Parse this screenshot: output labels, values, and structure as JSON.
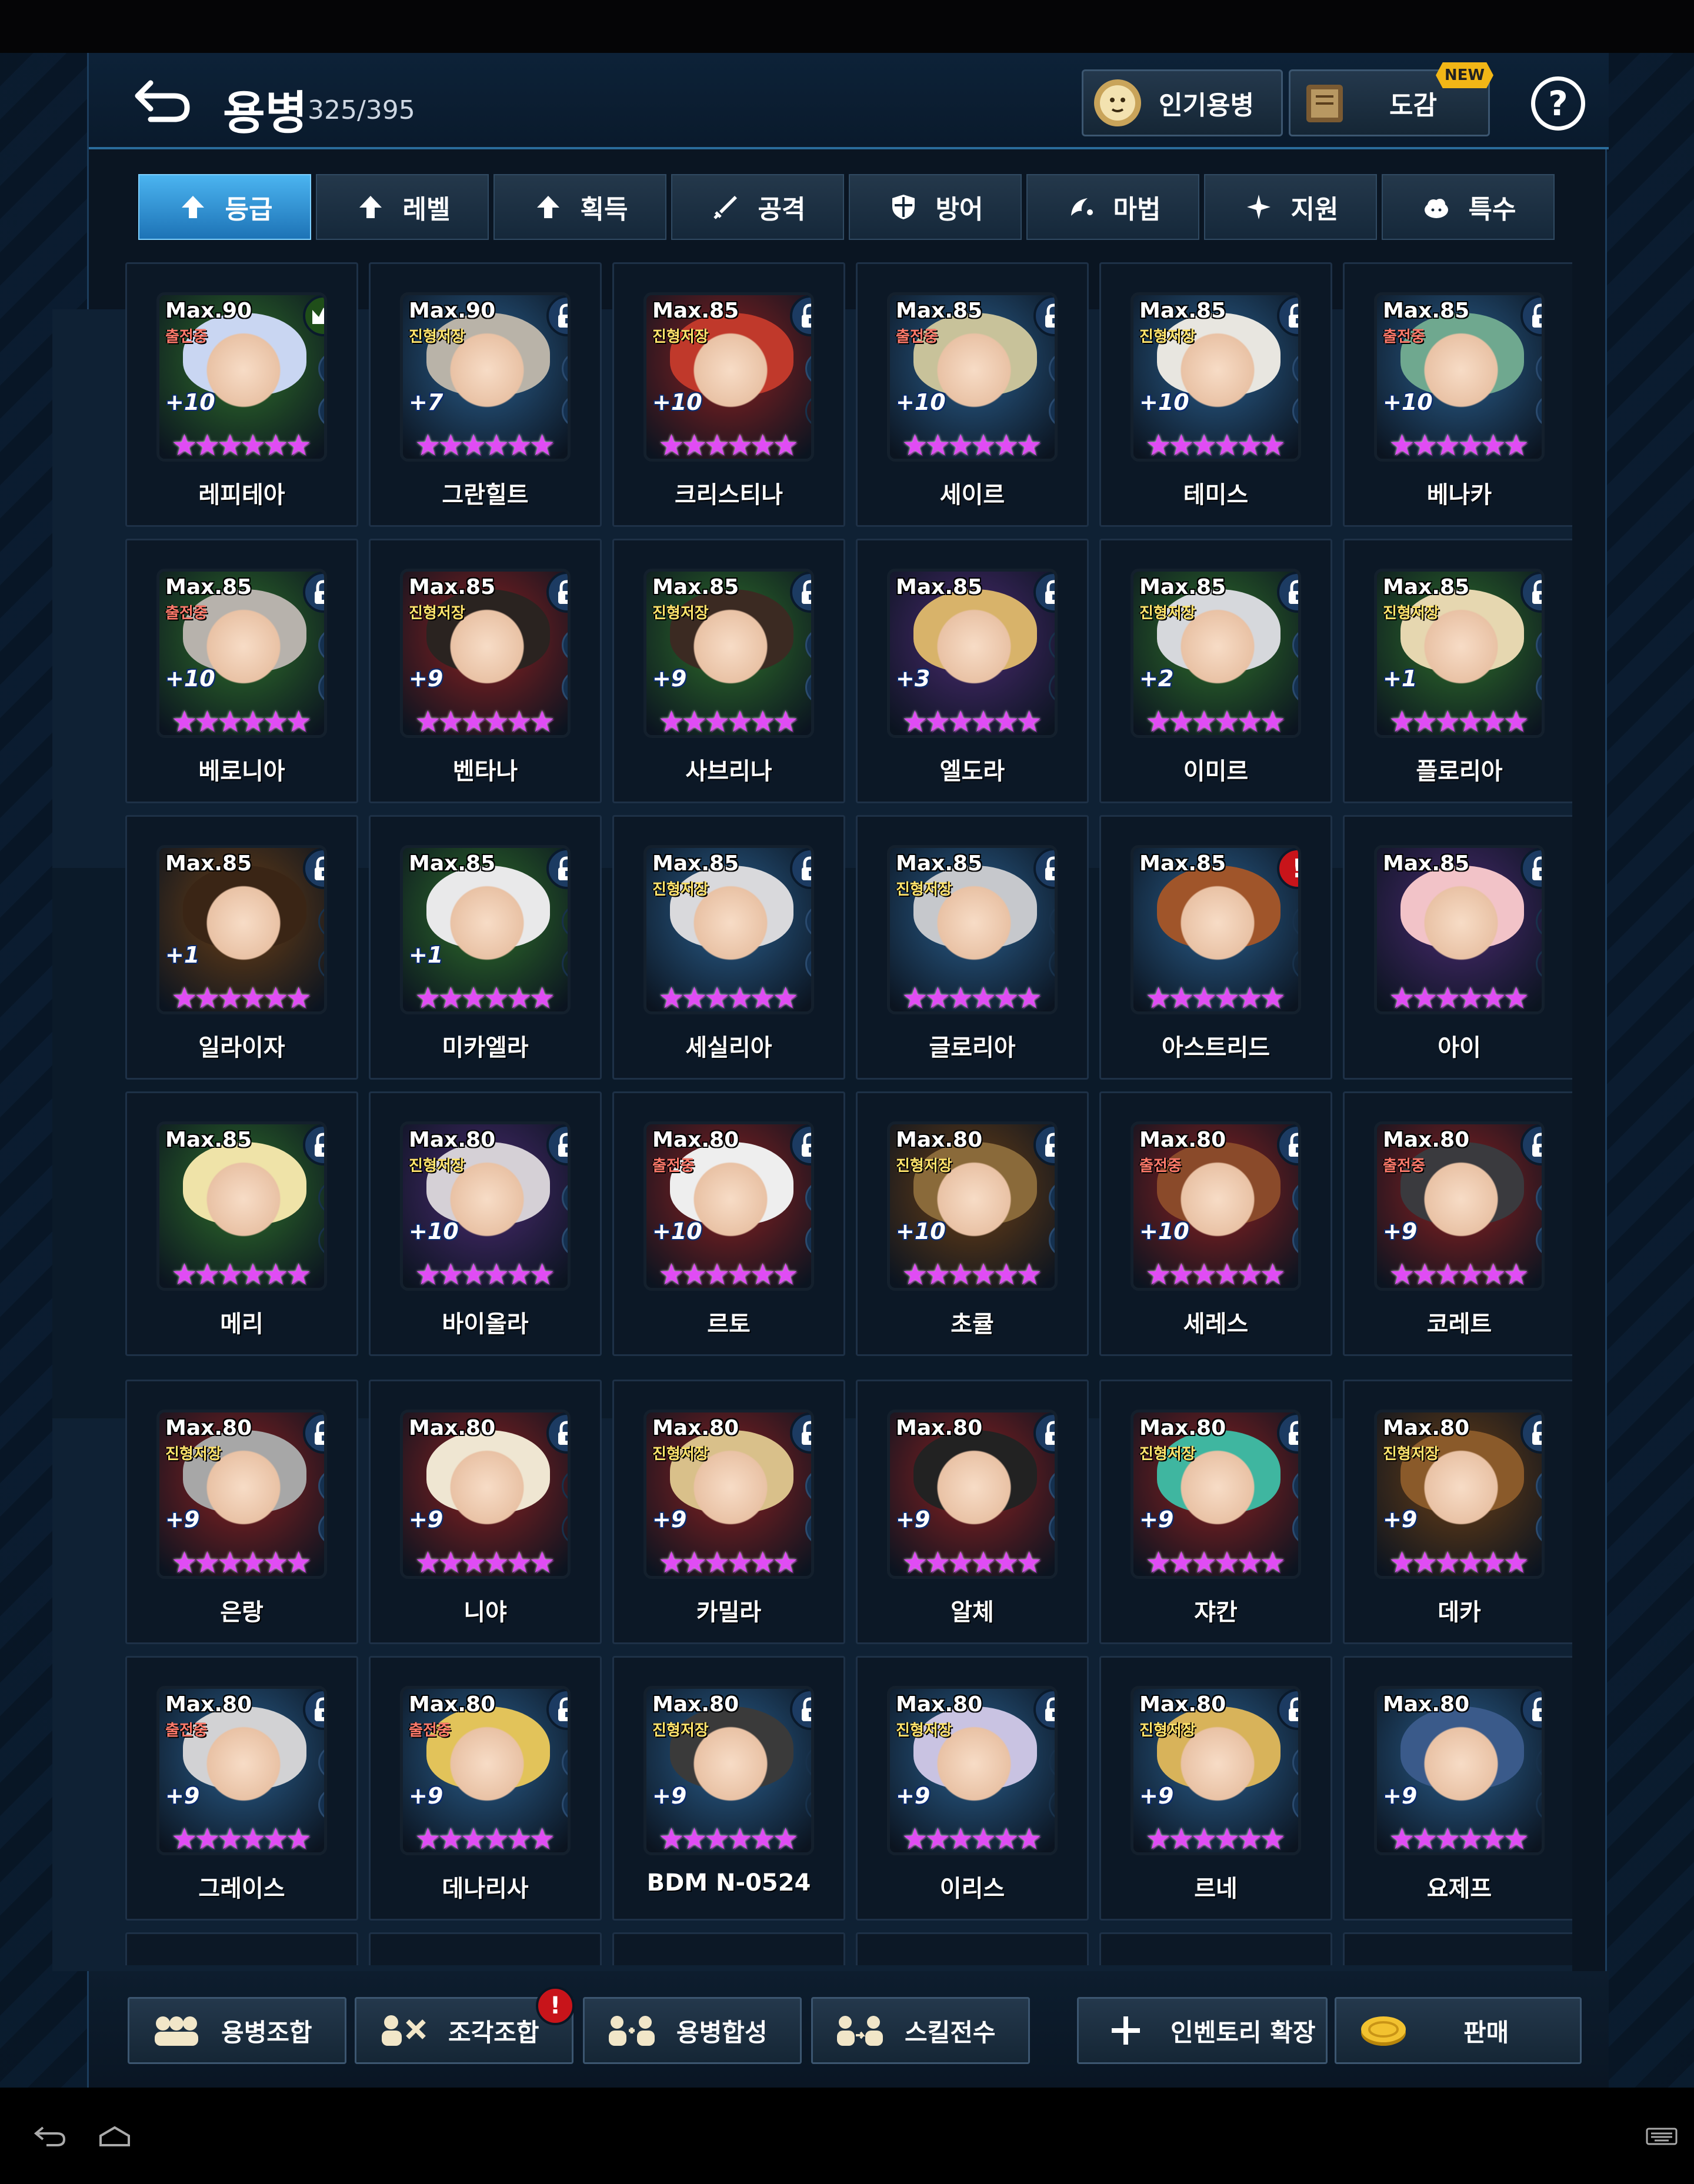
{
  "header": {
    "title": "용병",
    "count": "325/395",
    "popular_label": "인기용병",
    "book_label": "도감",
    "new_badge": "NEW",
    "help_label": "?"
  },
  "tabs": [
    {
      "label": "등급",
      "icon": "arrow-up-icon",
      "selected": true
    },
    {
      "label": "레벨",
      "icon": "arrow-up-icon",
      "selected": false
    },
    {
      "label": "획득",
      "icon": "arrow-up-icon",
      "selected": false
    },
    {
      "label": "공격",
      "icon": "sword-icon",
      "selected": false
    },
    {
      "label": "방어",
      "icon": "shield-icon",
      "selected": false
    },
    {
      "label": "마법",
      "icon": "magic-icon",
      "selected": false
    },
    {
      "label": "지원",
      "icon": "sparkle-icon",
      "selected": false
    },
    {
      "label": "특수",
      "icon": "cloud-icon",
      "selected": false
    }
  ],
  "heroes": [
    {
      "name": "레피테아",
      "max": "Max.90",
      "status": "출전중",
      "plus": "+10",
      "badge": "crown",
      "art": "#2f6f2a",
      "hair": "#c9d6f2",
      "runes": [
        "rune",
        "rune"
      ]
    },
    {
      "name": "그란힐트",
      "max": "Max.90",
      "status": "진형저장",
      "plus": "+7",
      "badge": "lock",
      "art": "#2a5e8c",
      "hair": "#b9b3a8",
      "runes": [
        "rune",
        "rune"
      ]
    },
    {
      "name": "크리스티나",
      "max": "Max.85",
      "status": "진형저장",
      "plus": "+10",
      "badge": "lock",
      "art": "#8b2020",
      "hair": "#c0392b",
      "runes": [
        "rune",
        "empty"
      ]
    },
    {
      "name": "세이르",
      "max": "Max.85",
      "status": "출전중",
      "plus": "+10",
      "badge": "lock",
      "art": "#2a5e8c",
      "hair": "#c8c29a",
      "runes": [
        "rune",
        "rune"
      ]
    },
    {
      "name": "테미스",
      "max": "Max.85",
      "status": "진형저장",
      "plus": "+10",
      "badge": "lock",
      "art": "#2a5e8c",
      "hair": "#e8e6e0",
      "runes": [
        "rune",
        "rune"
      ]
    },
    {
      "name": "베나카",
      "max": "Max.85",
      "status": "출전중",
      "plus": "+10",
      "badge": "lock",
      "art": "#2a5e8c",
      "hair": "#6fa88f",
      "runes": [
        "rune",
        "rune"
      ]
    },
    {
      "name": "베로니아",
      "max": "Max.85",
      "status": "출전중",
      "plus": "+10",
      "badge": "lock",
      "art": "#2f6f2a",
      "hair": "#b7b2ac",
      "runes": [
        "rune",
        "rune"
      ]
    },
    {
      "name": "벤타나",
      "max": "Max.85",
      "status": "진형저장",
      "plus": "+9",
      "badge": "lock",
      "art": "#8b2020",
      "hair": "#2a2320",
      "runes": [
        "rune",
        "rune"
      ]
    },
    {
      "name": "사브리나",
      "max": "Max.85",
      "status": "진형저장",
      "plus": "+9",
      "badge": "lock",
      "art": "#2f6f2a",
      "hair": "#3b2a22",
      "runes": [
        "rune",
        "rune"
      ]
    },
    {
      "name": "엘도라",
      "max": "Max.85",
      "status": "",
      "plus": "+3",
      "badge": "lock",
      "art": "#4a2a70",
      "hair": "#d8b36a",
      "runes": [
        "empty",
        "empty"
      ]
    },
    {
      "name": "이미르",
      "max": "Max.85",
      "status": "진형저장",
      "plus": "+2",
      "badge": "lock",
      "art": "#2f6f2a",
      "hair": "#d6d8dc",
      "runes": [
        "rune",
        "rune"
      ]
    },
    {
      "name": "플로리아",
      "max": "Max.85",
      "status": "진형저장",
      "plus": "+1",
      "badge": "lock",
      "art": "#2f6f2a",
      "hair": "#e6d7b0",
      "runes": [
        "rune",
        "rune"
      ]
    },
    {
      "name": "일라이자",
      "max": "Max.85",
      "status": "",
      "plus": "+1",
      "badge": "lock",
      "art": "#6b3f15",
      "hair": "#3a2515",
      "runes": [
        "empty",
        "empty"
      ]
    },
    {
      "name": "미카엘라",
      "max": "Max.85",
      "status": "",
      "plus": "+1",
      "badge": "lock",
      "art": "#2f6f2a",
      "hair": "#e9e9ea",
      "runes": [
        "empty",
        "empty"
      ]
    },
    {
      "name": "세실리아",
      "max": "Max.85",
      "status": "진형저장",
      "plus": "",
      "badge": "lock",
      "art": "#2a5e8c",
      "hair": "#d9d9dc",
      "runes": [
        "rune",
        "rune"
      ]
    },
    {
      "name": "글로리아",
      "max": "Max.85",
      "status": "진형저장",
      "plus": "",
      "badge": "lock",
      "art": "#2a5e8c",
      "hair": "#c6c8cc",
      "runes": [
        "empty",
        "empty"
      ]
    },
    {
      "name": "아스트리드",
      "max": "Max.85",
      "status": "",
      "plus": "",
      "badge": "alert",
      "art": "#2a5e8c",
      "hair": "#a0552a",
      "runes": [
        "empty",
        "empty"
      ]
    },
    {
      "name": "아이",
      "max": "Max.85",
      "status": "",
      "plus": "",
      "badge": "lock",
      "art": "#4a2a70",
      "hair": "#f2c3c8",
      "runes": [
        "empty",
        "empty"
      ]
    },
    {
      "name": "메리",
      "max": "Max.85",
      "status": "",
      "plus": "",
      "badge": "lock",
      "art": "#2f6f2a",
      "hair": "#efe3a8",
      "runes": [
        "empty",
        "empty"
      ]
    },
    {
      "name": "바이올라",
      "max": "Max.80",
      "status": "진형저장",
      "plus": "+10",
      "badge": "lock",
      "art": "#4a2a70",
      "hair": "#d5d0d6",
      "runes": [
        "rune",
        "rune"
      ]
    },
    {
      "name": "르토",
      "max": "Max.80",
      "status": "출전중",
      "plus": "+10",
      "badge": "lock",
      "art": "#8b2020",
      "hair": "#eeeeee",
      "runes": [
        "rune",
        "rune"
      ]
    },
    {
      "name": "초큘",
      "max": "Max.80",
      "status": "진형저장",
      "plus": "+10",
      "badge": "lock",
      "art": "#6b3f15",
      "hair": "#8a6a3a",
      "runes": [
        "rune",
        "rune"
      ]
    },
    {
      "name": "세레스",
      "max": "Max.80",
      "status": "출전중",
      "plus": "+10",
      "badge": "lock",
      "art": "#8b2020",
      "hair": "#8a4a2a",
      "runes": [
        "rune",
        "rune"
      ]
    },
    {
      "name": "코레트",
      "max": "Max.80",
      "status": "출전중",
      "plus": "+9",
      "badge": "lock",
      "art": "#8b2020",
      "hair": "#3a3a3e",
      "runes": [
        "rune",
        "rune"
      ]
    },
    {
      "name": "은랑",
      "max": "Max.80",
      "status": "진형저장",
      "plus": "+9",
      "badge": "lock",
      "art": "#8b2020",
      "hair": "#a7a7a7",
      "runes": [
        "rune",
        "rune"
      ]
    },
    {
      "name": "니야",
      "max": "Max.80",
      "status": "",
      "plus": "+9",
      "badge": "lock",
      "art": "#8b2020",
      "hair": "#efe6d2",
      "runes": [
        "empty",
        "empty"
      ]
    },
    {
      "name": "카밀라",
      "max": "Max.80",
      "status": "진형저장",
      "plus": "+9",
      "badge": "lock",
      "art": "#8b2020",
      "hair": "#d9c08a",
      "runes": [
        "rune",
        "rune"
      ]
    },
    {
      "name": "알체",
      "max": "Max.80",
      "status": "",
      "plus": "+9",
      "badge": "lock",
      "art": "#8b2020",
      "hair": "#222",
      "runes": [
        "rune",
        "rune"
      ]
    },
    {
      "name": "쟈칸",
      "max": "Max.80",
      "status": "진형저장",
      "plus": "+9",
      "badge": "lock",
      "art": "#8b2020",
      "hair": "#3fb6a0",
      "runes": [
        "rune",
        "rune"
      ]
    },
    {
      "name": "데카",
      "max": "Max.80",
      "status": "진형저장",
      "plus": "+9",
      "badge": "lock",
      "art": "#6b3f15",
      "hair": "#8a5a2a",
      "runes": [
        "rune",
        "rune"
      ]
    },
    {
      "name": "그레이스",
      "max": "Max.80",
      "status": "출전중",
      "plus": "+9",
      "badge": "lock",
      "art": "#2a5e8c",
      "hair": "#d2d2d4",
      "runes": [
        "rune",
        "rune"
      ]
    },
    {
      "name": "데나리사",
      "max": "Max.80",
      "status": "출전중",
      "plus": "+9",
      "badge": "lock",
      "art": "#2a5e8c",
      "hair": "#e2c35a",
      "runes": [
        "rune",
        "rune"
      ]
    },
    {
      "name": "BDM N-0524",
      "max": "Max.80",
      "status": "진형저장",
      "plus": "+9",
      "badge": "lock",
      "art": "#2a5e8c",
      "hair": "#3a3a3a",
      "runes": [
        "empty",
        "empty"
      ]
    },
    {
      "name": "이리스",
      "max": "Max.80",
      "status": "진형저장",
      "plus": "+9",
      "badge": "lock",
      "art": "#2a5e8c",
      "hair": "#c9c3e2",
      "runes": [
        "empty",
        "empty"
      ]
    },
    {
      "name": "르네",
      "max": "Max.80",
      "status": "진형저장",
      "plus": "+9",
      "badge": "lock",
      "art": "#2a5e8c",
      "hair": "#d8b35a",
      "runes": [
        "rune",
        "rune"
      ]
    },
    {
      "name": "요제프",
      "max": "Max.80",
      "status": "",
      "plus": "+9",
      "badge": "lock",
      "art": "#2a5e8c",
      "hair": "#3a5a8a",
      "runes": [
        "empty",
        "empty"
      ]
    }
  ],
  "bottom": {
    "combine": "용병조합",
    "fragment": "조각조합",
    "fragment_badge": "!",
    "synth": "용병합성",
    "skill": "스킬전수",
    "expand": "인벤토리 확장",
    "sell": "판매"
  },
  "colors": {
    "accent": "#4bb4f0",
    "star": "#e04cf4",
    "status_active": "#ff7a6b",
    "status_saved": "#ffe36b"
  }
}
